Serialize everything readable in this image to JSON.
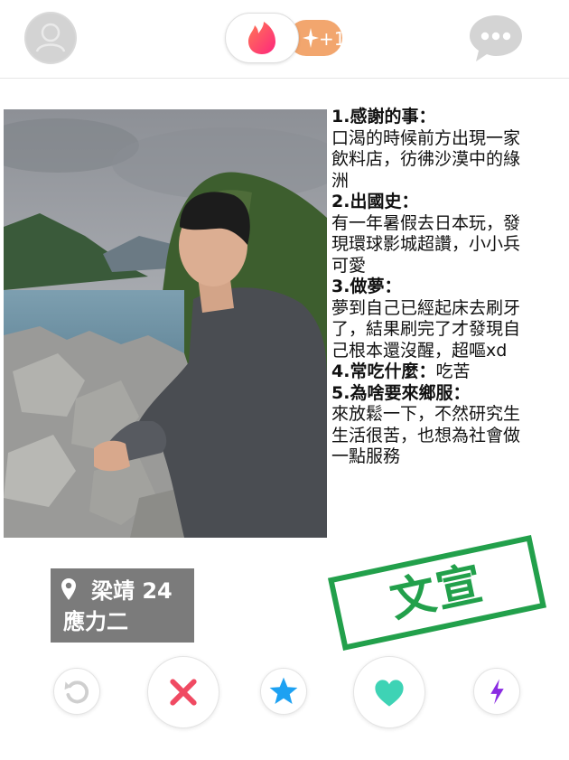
{
  "header": {
    "profile_icon": "profile-avatar-icon",
    "app_icon": "tinder-flame-icon",
    "boost_count": "+1",
    "messages_icon": "chat-bubble-icon",
    "colors": {
      "flame": "#fd5068",
      "boost": "#f2a66e"
    }
  },
  "card": {
    "photo_description": "photo",
    "qa": [
      {
        "q": "1.感謝的事：",
        "a_lines": [
          "口渴的時候前方出現一家",
          "飲料店，彷彿沙漠中的綠",
          "洲"
        ]
      },
      {
        "q": "2.出國史：",
        "a_lines": [
          "有一年暑假去日本玩，發",
          "現環球影城超讚，小小兵",
          "可愛"
        ]
      },
      {
        "q": "3.做夢：",
        "a_lines": [
          "夢到自己已經起床去刷牙",
          "了，結果刷完了才發現自",
          "己根本還沒醒，超嘔xd"
        ]
      },
      {
        "q": "4.常吃什麼：",
        "a_inline": "吃苦"
      },
      {
        "q": "5.為啥要來鄉服：",
        "a_lines": [
          "來放鬆一下，不然研究生",
          "生活很苦，也想為社會做",
          "一點服務"
        ]
      }
    ],
    "name_age": "梁靖 24",
    "department": "應力二",
    "stamp": "文宣",
    "stamp_color": "#22a04b"
  },
  "actions": {
    "rewind_icon": "rewind-icon",
    "nope_icon": "close-x-icon",
    "super_like_icon": "star-icon",
    "like_icon": "heart-icon",
    "boost_icon": "lightning-bolt-icon",
    "colors": {
      "rewind": "#cfcfcf",
      "nope": "#f04a62",
      "super_like": "#1da1f2",
      "like": "#3ed3b5",
      "boost": "#8a2be2"
    }
  }
}
